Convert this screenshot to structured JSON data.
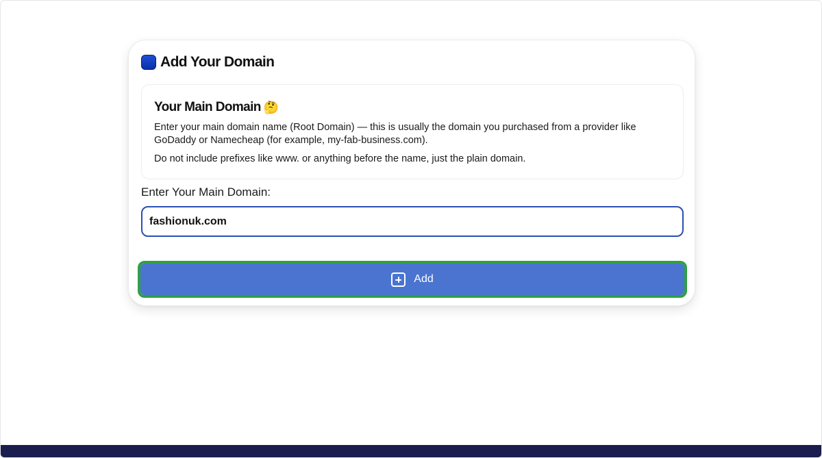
{
  "card": {
    "title": "Add Your Domain",
    "icon": "database-icon"
  },
  "info": {
    "title": "Your Main Domain",
    "emoji": "🤔",
    "paragraph1": "Enter your main domain name (Root Domain) — this is usually the domain you purchased from a provider like GoDaddy or Namecheap (for example, my-fab-business.com).",
    "paragraph2": "Do not include prefixes like www. or anything before the name, just the plain domain."
  },
  "form": {
    "label": "Enter Your Main Domain:",
    "value": "fashionuk.com"
  },
  "actions": {
    "add_label": "Add",
    "add_icon": "plus-square-icon"
  },
  "colors": {
    "accent": "#4a74d0",
    "highlight": "#2fa043",
    "input_border": "#2a4fb0",
    "footer": "#1a1d4e"
  }
}
